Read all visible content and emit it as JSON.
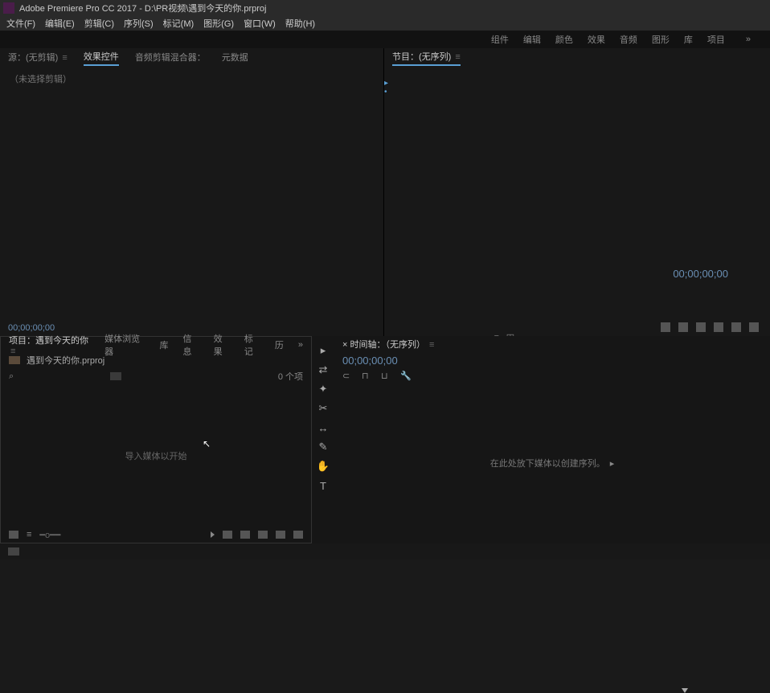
{
  "app": {
    "title": "Adobe Premiere Pro CC 2017 - D:\\PR视频\\遇到今天的你.prproj"
  },
  "menu": {
    "items": [
      "文件(F)",
      "编辑(E)",
      "剪辑(C)",
      "序列(S)",
      "标记(M)",
      "图形(G)",
      "窗口(W)",
      "帮助(H)"
    ]
  },
  "workspace": {
    "items": [
      "组件",
      "编辑",
      "颜色",
      "效果",
      "音频",
      "图形",
      "库",
      "项目"
    ],
    "chevron": "»"
  },
  "source": {
    "tabs": {
      "source": "源：(无剪辑)",
      "effect_controls": "效果控件",
      "audio_mixer": "音频剪辑混合器：",
      "metadata": "元数据"
    },
    "empty": "（未选择剪辑）",
    "timecode": "00;00;00;00"
  },
  "program": {
    "tab": "节目：(无序列)",
    "timecode": "00;00;00;00"
  },
  "project": {
    "tabs": {
      "project": "项目：遇到今天的你",
      "media_browser": "媒体浏览器",
      "lib": "库",
      "info": "信息",
      "effects": "效果",
      "markers": "标记",
      "history": "历"
    },
    "chevron": "»",
    "file": "遇到今天的你.prproj",
    "item_count": "0 个项",
    "empty_hint": "导入媒体以开始"
  },
  "timeline": {
    "tab": "× 时间轴：（无序列）",
    "timecode": "00;00;00;00",
    "drop_hint": "在此处放下媒体以创建序列。",
    "arrow": "▸"
  },
  "tools": {
    "icons": [
      "▸",
      "⇄",
      "✦",
      "✂",
      "↔",
      "✎",
      "✋",
      "T"
    ]
  }
}
